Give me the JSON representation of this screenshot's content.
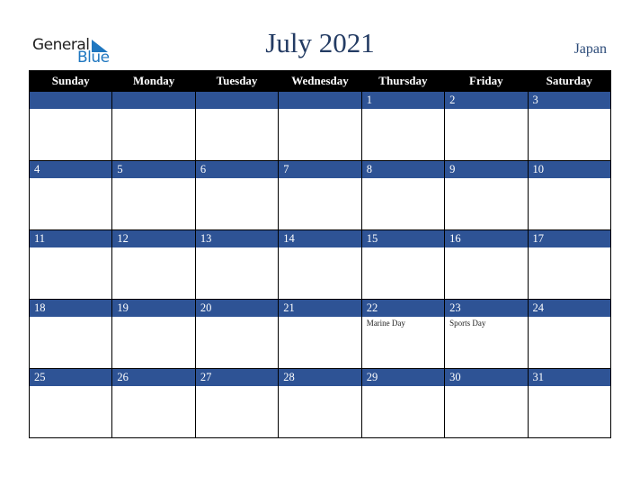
{
  "logo": {
    "line1": "General",
    "line2": "Blue"
  },
  "title": "July 2021",
  "country": "Japan",
  "colors": {
    "header_bg": "#000000",
    "day_band": "#2e5395",
    "title": "#233b63",
    "logo_blue": "#1f77c0"
  },
  "weekdays": [
    "Sunday",
    "Monday",
    "Tuesday",
    "Wednesday",
    "Thursday",
    "Friday",
    "Saturday"
  ],
  "weeks": [
    [
      {
        "day": "",
        "event": ""
      },
      {
        "day": "",
        "event": ""
      },
      {
        "day": "",
        "event": ""
      },
      {
        "day": "",
        "event": ""
      },
      {
        "day": "1",
        "event": ""
      },
      {
        "day": "2",
        "event": ""
      },
      {
        "day": "3",
        "event": ""
      }
    ],
    [
      {
        "day": "4",
        "event": ""
      },
      {
        "day": "5",
        "event": ""
      },
      {
        "day": "6",
        "event": ""
      },
      {
        "day": "7",
        "event": ""
      },
      {
        "day": "8",
        "event": ""
      },
      {
        "day": "9",
        "event": ""
      },
      {
        "day": "10",
        "event": ""
      }
    ],
    [
      {
        "day": "11",
        "event": ""
      },
      {
        "day": "12",
        "event": ""
      },
      {
        "day": "13",
        "event": ""
      },
      {
        "day": "14",
        "event": ""
      },
      {
        "day": "15",
        "event": ""
      },
      {
        "day": "16",
        "event": ""
      },
      {
        "day": "17",
        "event": ""
      }
    ],
    [
      {
        "day": "18",
        "event": ""
      },
      {
        "day": "19",
        "event": ""
      },
      {
        "day": "20",
        "event": ""
      },
      {
        "day": "21",
        "event": ""
      },
      {
        "day": "22",
        "event": "Marine Day"
      },
      {
        "day": "23",
        "event": "Sports Day"
      },
      {
        "day": "24",
        "event": ""
      }
    ],
    [
      {
        "day": "25",
        "event": ""
      },
      {
        "day": "26",
        "event": ""
      },
      {
        "day": "27",
        "event": ""
      },
      {
        "day": "28",
        "event": ""
      },
      {
        "day": "29",
        "event": ""
      },
      {
        "day": "30",
        "event": ""
      },
      {
        "day": "31",
        "event": ""
      }
    ]
  ]
}
